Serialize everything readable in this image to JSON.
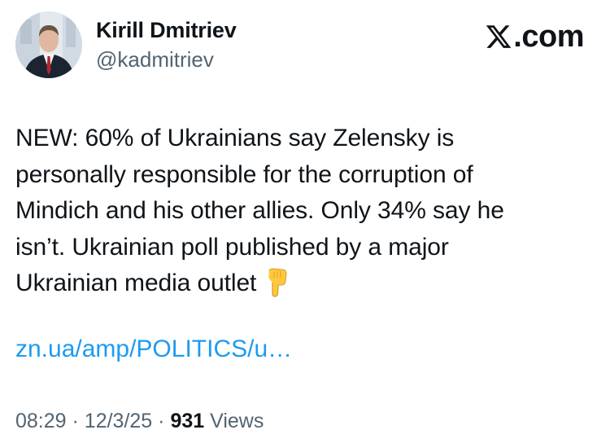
{
  "author": {
    "display_name": "Kirill Dmitriev",
    "handle": "@kadmitriev"
  },
  "site": {
    "domain_suffix": ".com",
    "logo_icon": "x-logo-icon"
  },
  "tweet": {
    "lines": [
      "NEW: 60% of Ukrainians say Zelensky is",
      "personally responsible for the corruption of",
      "Mindich and his other allies. Only 34% say he",
      "isn’t. Ukrainian poll published by a major",
      "Ukrainian media outlet"
    ],
    "emoji": "backhand-index-pointing-down-icon",
    "link": "zn.ua/amp/POLITICS/u…"
  },
  "meta": {
    "time": "08:29",
    "separator": "·",
    "date": "12/3/25",
    "views_count": "931",
    "views_label": "Views"
  },
  "colors": {
    "text": "#0f1419",
    "secondary": "#536471",
    "link": "#1d9bf0"
  }
}
